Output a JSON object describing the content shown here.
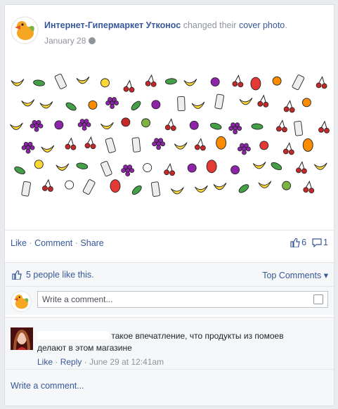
{
  "post": {
    "page_name": "Интернет-Гипермаркет Утконос",
    "action_text": "changed their",
    "action_link": "cover photo",
    "action_end": ".",
    "date": "January 28"
  },
  "actions": {
    "like": "Like",
    "comment": "Comment",
    "share": "Share",
    "sep": "·",
    "like_count": "6",
    "comment_count": "1"
  },
  "likes": {
    "text": "5 people like this.",
    "top_comments": "Top Comments ▾"
  },
  "comment_input": {
    "placeholder": "Write a comment..."
  },
  "comment": {
    "text": "такое впечатление, что продукты из помоев делают в этом магазине",
    "like": "Like",
    "reply": "Reply",
    "time": "· June 29 at 12:41am"
  },
  "bottom_write": "Write a comment...",
  "colors": {
    "link": "#365899",
    "muted": "#90949c",
    "bg": "#e9ebee"
  }
}
